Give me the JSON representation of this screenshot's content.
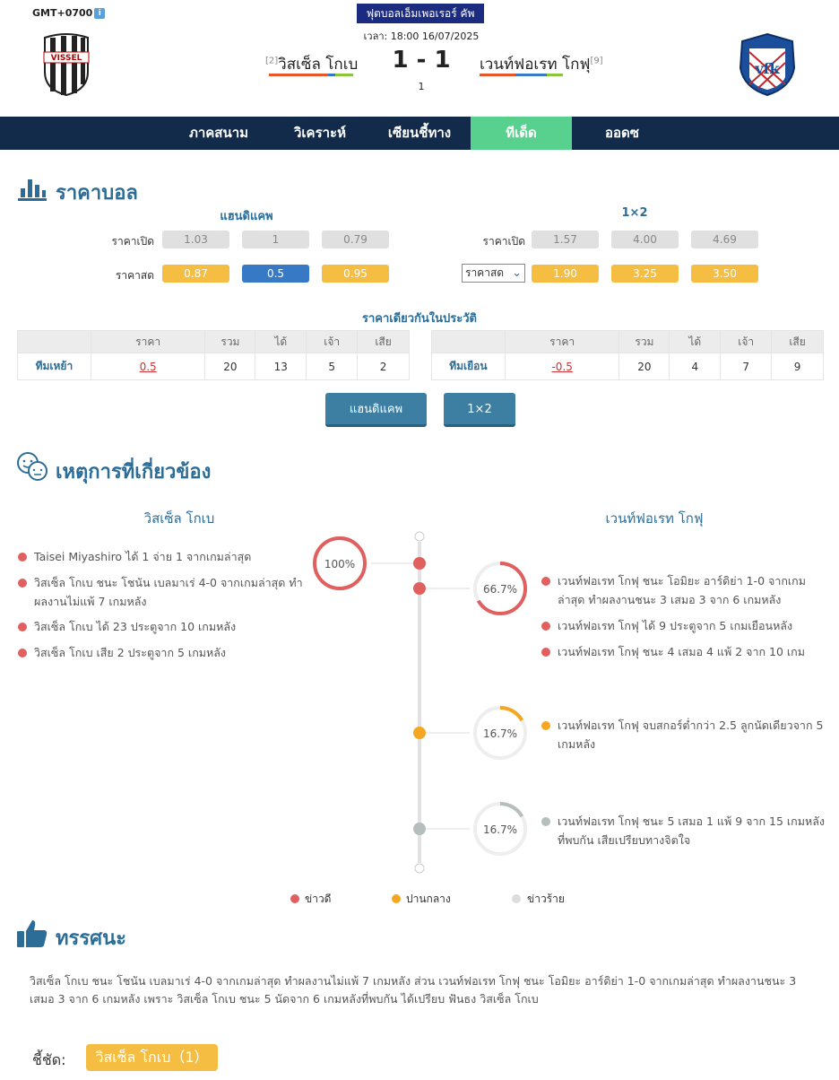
{
  "header": {
    "timezone": "GMT+0700",
    "league": "ฟุตบอลเอ็มเพอเรอร์ คัพ",
    "time": "เวลา: 18:00 16/07/2025",
    "home": {
      "name": "วิสเซ็ล โกเบ",
      "rank": "[2]",
      "logo_text": "VISSEL"
    },
    "away": {
      "name": "เวนท์ฟอเรท โกฟุ",
      "rank": "[9]",
      "logo_text": "vfk"
    },
    "score": "1 - 1",
    "sub_score": "1"
  },
  "nav": {
    "items": [
      "ภาคสนาม",
      "วิเคราะห์",
      "เซียนชี้ทาง",
      "ทีเด็ด",
      "ออดซ"
    ],
    "active": 3
  },
  "odds": {
    "title": "ราคาบอล",
    "handicap": {
      "title": "แฮนดิแคพ",
      "open_label": "ราคาเปิด",
      "open": [
        "1.03",
        "1",
        "0.79"
      ],
      "live_label": "ราคาสด",
      "live": [
        "0.87",
        "0.5",
        "0.95"
      ]
    },
    "x12": {
      "title": "1×2",
      "open_label": "ราคาเปิด",
      "open": [
        "1.57",
        "4.00",
        "4.69"
      ],
      "live_select": "ราคาสด",
      "live": [
        "1.90",
        "3.25",
        "3.50"
      ]
    },
    "history": {
      "title": "ราคาเดียวกันในประวัติ",
      "headers": [
        "",
        "ราคา",
        "รวม",
        "ได้",
        "เจ้า",
        "เสีย"
      ],
      "left": [
        "ทีมเหย้า",
        "0.5",
        "20",
        "13",
        "5",
        "2"
      ],
      "right": [
        "ทีมเยือน",
        "-0.5",
        "20",
        "4",
        "7",
        "9"
      ]
    },
    "buttons": [
      "แฮนดิแคพ",
      "1×2"
    ]
  },
  "events": {
    "title": "เหตุการที่เกี่ยวข้อง",
    "home_team": "วิสเซ็ล โกเบ",
    "away_team": "เวนท์ฟอเรท โกฟุ",
    "home_items": [
      "Taisei Miyashiro ได้ 1 จ่าย 1 จากเกมล่าสุด",
      "วิสเซ็ล โกเบ ชนะ โชนัน เบลมาเร่ 4-0 จากเกมล่าสุด ทำผลงานไม่แพ้ 7 เกมหลัง",
      "วิสเซ็ล โกเบ ได้ 23 ประตูจาก 10 เกมหลัง",
      "วิสเซ็ล โกเบ เสีย 2 ประตูจาก 5 เกมหลัง"
    ],
    "home_pct": "100%",
    "away_groups": [
      {
        "pct": "66.7%",
        "level": 0.667,
        "color": "#e06060",
        "items": [
          "เวนท์ฟอเรท โกฟุ ชนะ โอมิยะ อาร์ดิย่า 1-0 จากเกมล่าสุด ทำผลงานชนะ 3 เสมอ 3 จาก 6 เกมหลัง",
          "เวนท์ฟอเรท โกฟุ ได้ 9 ประตูจาก 5 เกมเยือนหลัง",
          "เวนท์ฟอเรท โกฟุ ชนะ 4 เสมอ 4 แพ้ 2 จาก 10 เกม"
        ]
      },
      {
        "pct": "16.7%",
        "level": 0.167,
        "color": "#f5a623",
        "items": [
          "เวนท์ฟอเรท โกฟุ จบสกอร์ต่ำกว่า 2.5 ลูกนัดเดียวจาก 5 เกมหลัง"
        ]
      },
      {
        "pct": "16.7%",
        "level": 0.167,
        "color": "#b5bdbd",
        "items": [
          "เวนท์ฟอเรท โกฟุ ชนะ 5 เสมอ 1 แพ้ 9 จาก 15 เกมหลังที่พบกัน เสียเปรียบทางจิตใจ"
        ]
      }
    ],
    "legend": [
      "ข่าวดี",
      "ปานกลาง",
      "ข่าวร้าย"
    ]
  },
  "verdict": {
    "title": "ทรรศนะ",
    "text": "วิสเซ็ล โกเบ ชนะ โชนัน เบลมาเร่ 4-0 จากเกมล่าสุด ทำผลงานไม่แพ้ 7 เกมหลัง ส่วน เวนท์ฟอเรท โกฟุ ชนะ โอมิยะ อาร์ดิย่า 1-0 จากเกมล่าสุด ทำผลงานชนะ 3 เสมอ 3 จาก 6 เกมหลัง เพราะ วิสเซ็ล โกเบ ชนะ 5 นัดจาก 6 เกมหลังที่พบกัน ได้เปรียบ ฟันธง วิสเซ็ล โกเบ",
    "pick_label": "ชี้ชัด:",
    "pick": "วิสเซ็ล โกเบ（1）"
  },
  "colors": {
    "nav_bg": "#132b4a",
    "nav_active": "#58d08e",
    "accent": "#2c6d97",
    "good": "#e06060",
    "mid": "#f5a623",
    "bad": "#b5bdbd"
  }
}
